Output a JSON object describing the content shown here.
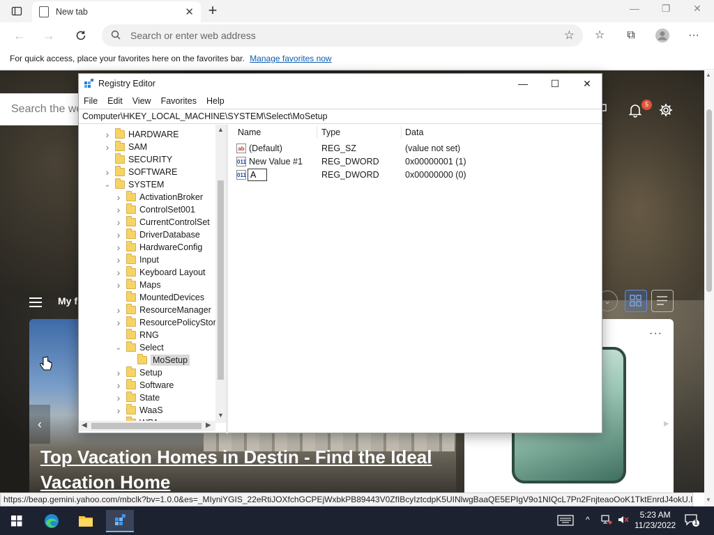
{
  "browser": {
    "tab_title": "New tab",
    "address_placeholder": "Search or enter web address",
    "favorites_message": "For quick access, place your favorites here on the favorites bar.",
    "favorites_link": "Manage favorites now",
    "status_url": "https://beap.gemini.yahoo.com/mbclk?bv=1.0.0&es=_MIyniYGIS_22eRtiJOXfchGCPEjWxbkPB89443V0ZfIBcyIztcdpK5UINlwgBaaQE5EPIgV9o1NIQcL7Pn2FnjteaoOoK1TktEnrdJ4okU.IAaK..."
  },
  "newtab": {
    "search_placeholder": "Search the we",
    "notification_count": "5",
    "feed_label": "My f",
    "headline": "Top Vacation Homes in Destin - Find the Ideal Vacation Home"
  },
  "registry": {
    "title": "Registry Editor",
    "menu": [
      "File",
      "Edit",
      "View",
      "Favorites",
      "Help"
    ],
    "address": "Computer\\HKEY_LOCAL_MACHINE\\SYSTEM\\Select\\MoSetup",
    "tree": [
      {
        "label": "HARDWARE",
        "level": 0,
        "expander": "closed"
      },
      {
        "label": "SAM",
        "level": 0,
        "expander": "closed"
      },
      {
        "label": "SECURITY",
        "level": 0,
        "expander": "none"
      },
      {
        "label": "SOFTWARE",
        "level": 0,
        "expander": "closed"
      },
      {
        "label": "SYSTEM",
        "level": 0,
        "expander": "open"
      },
      {
        "label": "ActivationBroker",
        "level": 1,
        "expander": "closed"
      },
      {
        "label": "ControlSet001",
        "level": 1,
        "expander": "closed"
      },
      {
        "label": "CurrentControlSet",
        "level": 1,
        "expander": "closed"
      },
      {
        "label": "DriverDatabase",
        "level": 1,
        "expander": "closed"
      },
      {
        "label": "HardwareConfig",
        "level": 1,
        "expander": "closed"
      },
      {
        "label": "Input",
        "level": 1,
        "expander": "closed"
      },
      {
        "label": "Keyboard Layout",
        "level": 1,
        "expander": "closed"
      },
      {
        "label": "Maps",
        "level": 1,
        "expander": "closed"
      },
      {
        "label": "MountedDevices",
        "level": 1,
        "expander": "none"
      },
      {
        "label": "ResourceManager",
        "level": 1,
        "expander": "closed"
      },
      {
        "label": "ResourcePolicyStore",
        "level": 1,
        "expander": "closed"
      },
      {
        "label": "RNG",
        "level": 1,
        "expander": "none"
      },
      {
        "label": "Select",
        "level": 1,
        "expander": "open"
      },
      {
        "label": "MoSetup",
        "level": 2,
        "expander": "none",
        "selected": true
      },
      {
        "label": "Setup",
        "level": 1,
        "expander": "closed"
      },
      {
        "label": "Software",
        "level": 1,
        "expander": "closed"
      },
      {
        "label": "State",
        "level": 1,
        "expander": "closed"
      },
      {
        "label": "WaaS",
        "level": 1,
        "expander": "closed"
      },
      {
        "label": "WPA",
        "level": 1,
        "expander": "closed"
      }
    ],
    "columns": {
      "name": "Name",
      "type": "Type",
      "data": "Data"
    },
    "values": [
      {
        "icon": "ab",
        "kind": "string",
        "name": "(Default)",
        "type": "REG_SZ",
        "data": "(value not set)"
      },
      {
        "icon": "011",
        "kind": "dword",
        "name": "New Value #1",
        "type": "REG_DWORD",
        "data": "0x00000001 (1)"
      },
      {
        "icon": "011",
        "kind": "dword",
        "name": "A",
        "type": "REG_DWORD",
        "data": "0x00000000 (0)",
        "editing": true
      }
    ]
  },
  "taskbar": {
    "time": "5:23 AM",
    "date": "11/23/2022",
    "notification_badge": "1"
  }
}
